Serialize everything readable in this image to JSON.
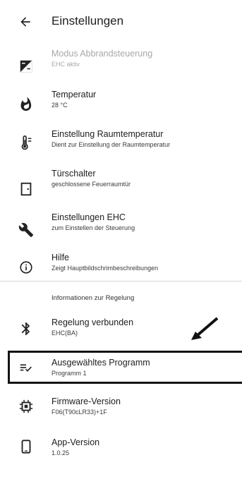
{
  "header": {
    "title": "Einstellungen",
    "back_icon": "arrow-left-icon"
  },
  "items": [
    {
      "title": "Modus Abbrandsteuerung",
      "subtitle": "EHC aktiv",
      "icon": "contrast-icon",
      "disabled": true
    },
    {
      "title": "Temperatur",
      "subtitle": "28 °C",
      "icon": "flame-icon"
    },
    {
      "title": "Einstellung Raumtemperatur",
      "subtitle": "Dient zur Einstellung der Raumtemperatur",
      "icon": "thermostat-icon"
    },
    {
      "title": "Türschalter",
      "subtitle": "geschlossene Feuerraumtür",
      "icon": "door-icon"
    },
    {
      "title": "Einstellungen EHC",
      "subtitle": "zum Einstellen der Steuerung",
      "icon": "wrench-icon"
    },
    {
      "title": "Hilfe",
      "subtitle": "Zeigt Hauptbildschrimbeschreibungen",
      "icon": "info-icon"
    }
  ],
  "section": {
    "title": "Informationen zur Regelung"
  },
  "info_items": [
    {
      "title": "Regelung verbunden",
      "subtitle": "EHC(BA)",
      "icon": "bluetooth-icon"
    },
    {
      "title": "Ausgewähltes Programm",
      "subtitle": "Programm 1",
      "icon": "playlist-check-icon",
      "highlighted": true
    },
    {
      "title": "Firmware-Version",
      "subtitle": "F06(T90cLR33)+1F",
      "icon": "chip-icon"
    },
    {
      "title": "App-Version",
      "subtitle": "1.0.25",
      "icon": "phone-icon"
    }
  ]
}
